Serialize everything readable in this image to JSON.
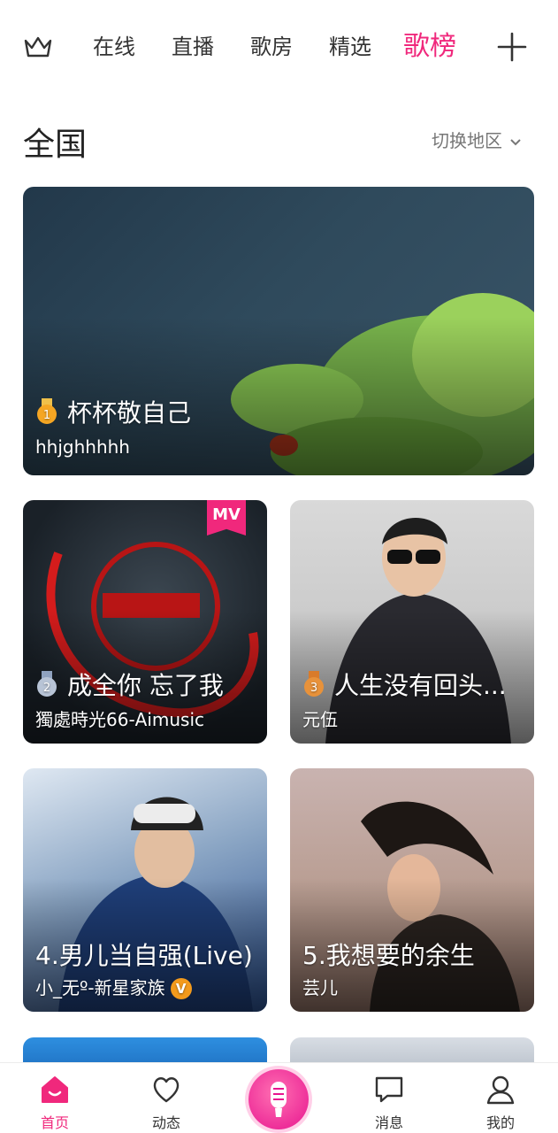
{
  "top_nav": {
    "tabs": [
      "在线",
      "直播",
      "歌房",
      "精选",
      "歌榜"
    ],
    "active_tab": "歌榜"
  },
  "region": {
    "title": "全国",
    "switch_label": "切换地区"
  },
  "charts": [
    {
      "rank": "1",
      "medal_color": "#f5a623",
      "title": "杯杯敬自己",
      "singer": "hhjghhhhh"
    },
    {
      "rank": "2",
      "medal_color": "#b8c4d6",
      "title": "成全你 忘了我",
      "singer": "獨處時光66-Aimusic",
      "badge": "MV"
    },
    {
      "rank": "3",
      "medal_color": "#e8923a",
      "title": "人生没有回头...",
      "singer": "元伍"
    },
    {
      "title": "4.男儿当自强(Live)",
      "singer": "小_无º-新星家族",
      "verified": "V"
    },
    {
      "title": "5.我想要的余生",
      "singer": "芸儿"
    }
  ],
  "bottom_nav": {
    "items": [
      "首页",
      "动态",
      "消息",
      "我的"
    ],
    "active": "首页"
  },
  "colors": {
    "accent": "#f0287c",
    "text": "#222222",
    "muted": "#777777"
  }
}
